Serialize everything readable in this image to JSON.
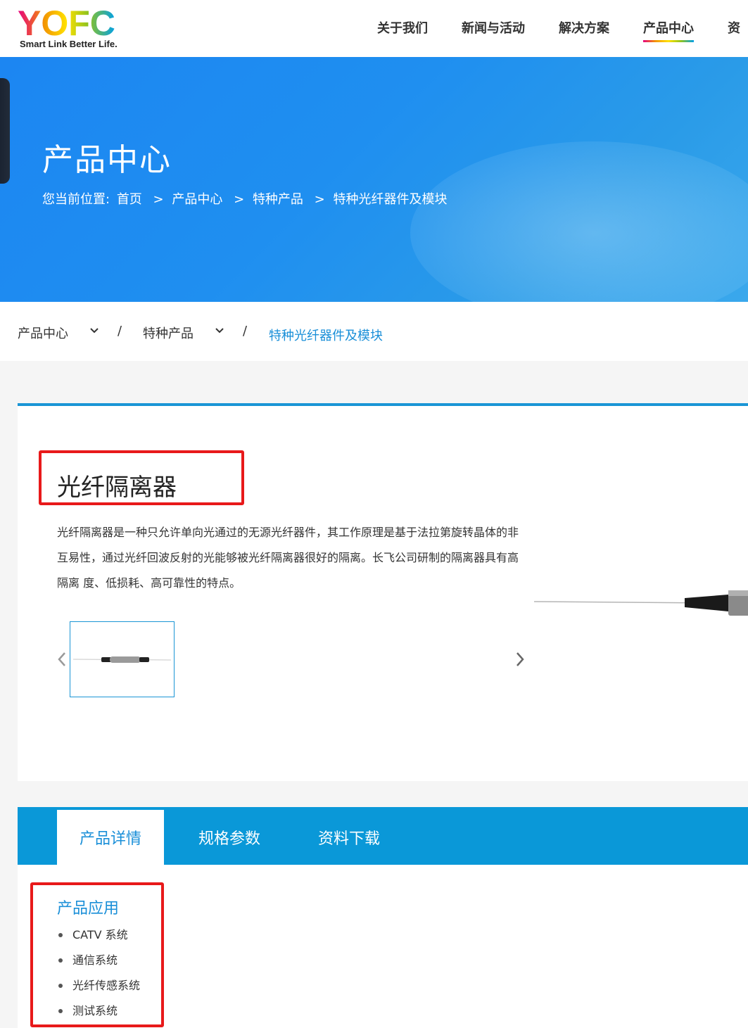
{
  "header": {
    "logo_text": "YOFC",
    "logo_tagline": "Smart Link Better Life.",
    "nav": [
      {
        "label": "关于我们",
        "active": false
      },
      {
        "label": "新闻与活动",
        "active": false
      },
      {
        "label": "解决方案",
        "active": false
      },
      {
        "label": "产品中心",
        "active": true
      },
      {
        "label": "资",
        "active": false
      }
    ]
  },
  "banner": {
    "title": "产品中心",
    "location_prefix": "您当前位置:",
    "breadcrumb": [
      "首页",
      "产品中心",
      "特种产品",
      "特种光纤器件及模块"
    ],
    "separator": ">"
  },
  "subnav": {
    "level1": "产品中心",
    "level2": "特种产品",
    "current": "特种光纤器件及模块",
    "separator": "/"
  },
  "product": {
    "title": "光纤隔离器",
    "description": "光纤隔离器是一种只允许单向光通过的无源光纤器件，其工作原理是基于法拉第旋转晶体的非互易性，通过光纤回波反射的光能够被光纤隔离器很好的隔离。长飞公司研制的隔离器具有高隔离 度、低损耗、高可靠性的特点。",
    "thumbnail_count": 1,
    "accent_color": "#1a95d5",
    "highlight_color": "#e8191a"
  },
  "tabs": [
    {
      "label": "产品详情",
      "active": true
    },
    {
      "label": "规格参数",
      "active": false
    },
    {
      "label": "资料下载",
      "active": false
    }
  ],
  "applications": {
    "heading": "产品应用",
    "items": [
      "CATV 系统",
      "通信系统",
      "光纤传感系统",
      "测试系统"
    ]
  }
}
